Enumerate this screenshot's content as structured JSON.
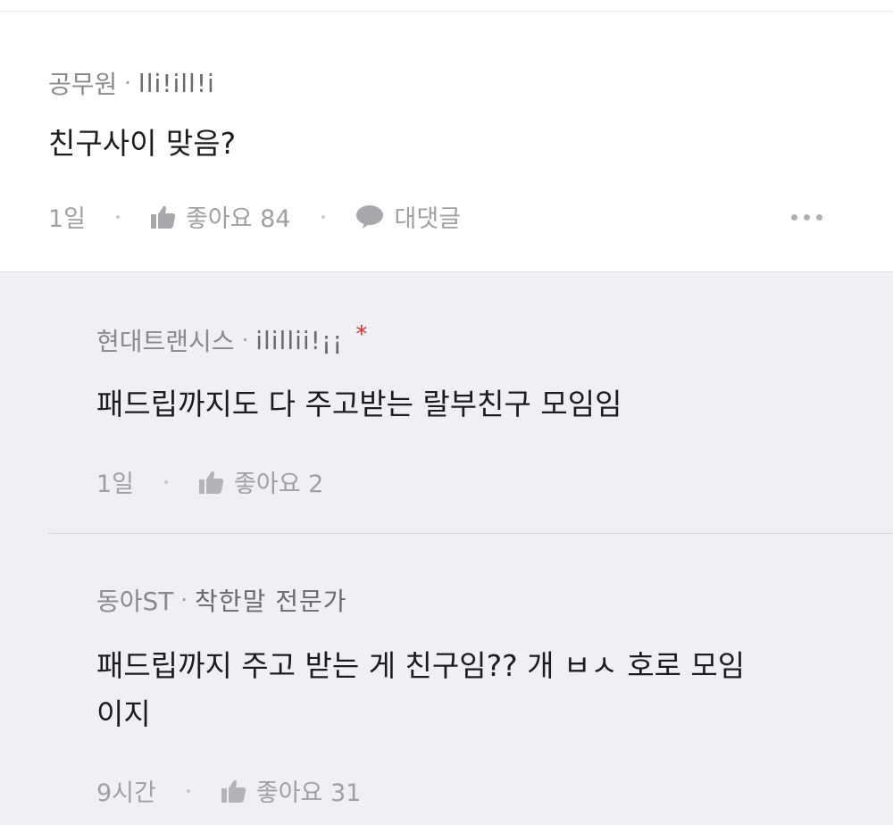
{
  "comment": {
    "author": "공무원",
    "badge": "lli!ill!i",
    "text": "친구사이 맞음?",
    "time": "1일",
    "like_label": "좋아요 84",
    "reply_label": "대댓글"
  },
  "replies": [
    {
      "author": "현대트랜시스",
      "badge": "ilillii!¡¡",
      "star": "*",
      "text": "패드립까지도 다 주고받는 랄부친구 모임임",
      "time": "1일",
      "like_label": "좋아요 2"
    },
    {
      "author": "동아ST",
      "badge": "착한말 전문가",
      "text_line1": "패드립까지 주고 받는 게 친구임?? 개 ㅂㅅ 호로 모임",
      "text_line2": "이지",
      "time": "9시간",
      "like_label": "좋아요 31"
    }
  ],
  "separator": "·",
  "colors": {
    "reply_background": "#efeff4",
    "star": "#d12b2b",
    "meta_text": "#a0a0a4"
  }
}
